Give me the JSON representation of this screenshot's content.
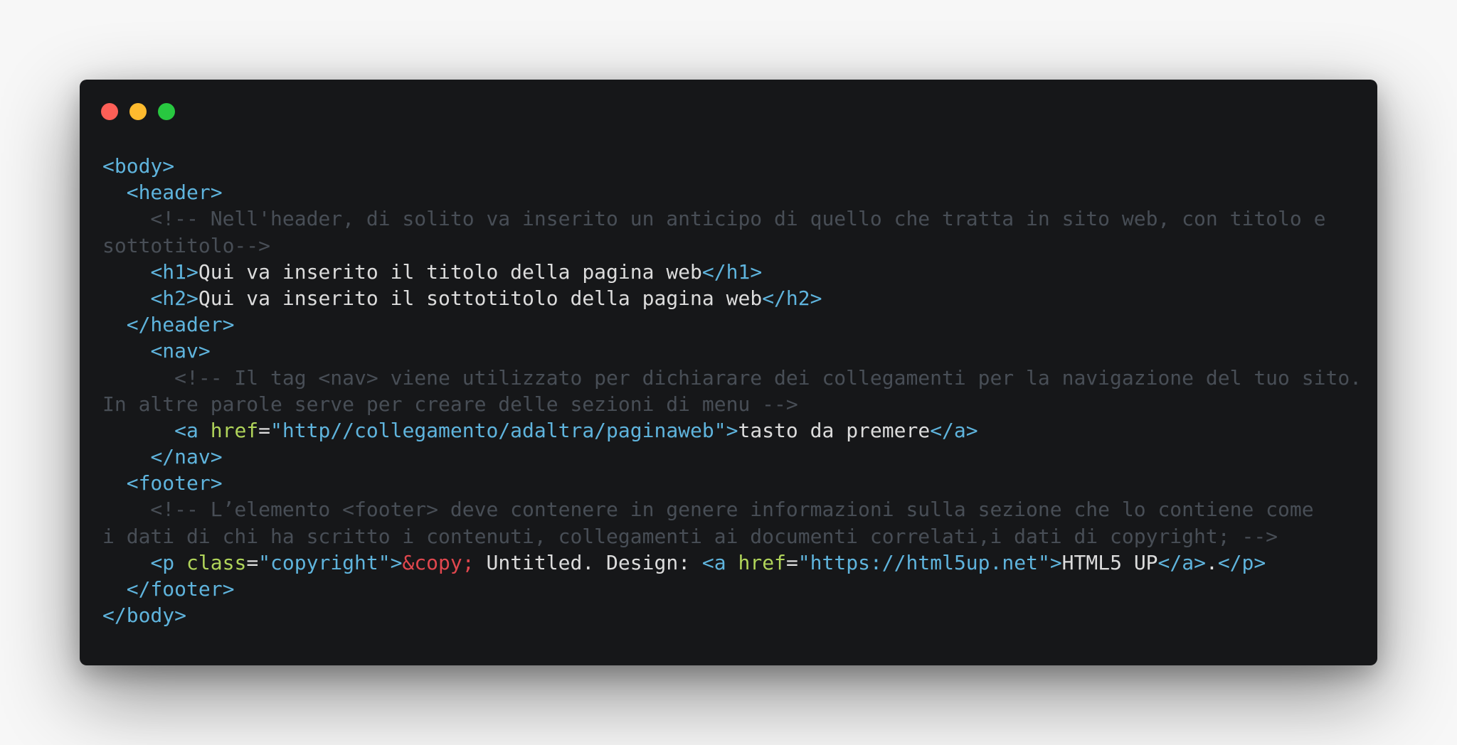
{
  "colors": {
    "background": "#f7f7f7",
    "window": "#161719",
    "tag": "#5fb4dd",
    "attribute": "#b0d45a",
    "string": "#5fb4dd",
    "entity": "#e0474e",
    "comment": "#484e56",
    "text": "#dcdcdc",
    "punctuation": "#dcdcdc"
  },
  "window_controls": [
    {
      "name": "close-button",
      "color": "#fe5f57"
    },
    {
      "name": "minimize-button",
      "color": "#febb2e"
    },
    {
      "name": "zoom-button",
      "color": "#28c840"
    }
  ],
  "code_lines": [
    [
      {
        "t": "tag",
        "v": "<body>"
      }
    ],
    [
      {
        "t": "text",
        "v": "  "
      },
      {
        "t": "tag",
        "v": "<header>"
      }
    ],
    [
      {
        "t": "comment",
        "v": "    <!-- Nell'header, di solito va inserito un anticipo di quello che tratta in sito web, con titolo e"
      }
    ],
    [
      {
        "t": "comment",
        "v": "sottotitolo-->"
      }
    ],
    [
      {
        "t": "text",
        "v": "    "
      },
      {
        "t": "tag",
        "v": "<h1>"
      },
      {
        "t": "text",
        "v": "Qui va inserito il titolo della pagina web"
      },
      {
        "t": "tag",
        "v": "</h1>"
      }
    ],
    [
      {
        "t": "text",
        "v": "    "
      },
      {
        "t": "tag",
        "v": "<h2>"
      },
      {
        "t": "text",
        "v": "Qui va inserito il sottotitolo della pagina web"
      },
      {
        "t": "tag",
        "v": "</h2>"
      }
    ],
    [
      {
        "t": "text",
        "v": "  "
      },
      {
        "t": "tag",
        "v": "</header>"
      }
    ],
    [
      {
        "t": "text",
        "v": "    "
      },
      {
        "t": "tag",
        "v": "<nav>"
      }
    ],
    [
      {
        "t": "comment",
        "v": "      <!-- Il tag <nav> viene utilizzato per dichiarare dei collegamenti per la navigazione del tuo sito."
      }
    ],
    [
      {
        "t": "comment",
        "v": "In altre parole serve per creare delle sezioni di menu -->"
      }
    ],
    [
      {
        "t": "text",
        "v": "      "
      },
      {
        "t": "tag",
        "v": "<a "
      },
      {
        "t": "attribute",
        "v": "href"
      },
      {
        "t": "punctuation",
        "v": "="
      },
      {
        "t": "string",
        "v": "\"http//collegamento/adaltra/paginaweb\""
      },
      {
        "t": "tag",
        "v": ">"
      },
      {
        "t": "text",
        "v": "tasto da premere"
      },
      {
        "t": "tag",
        "v": "</a>"
      }
    ],
    [
      {
        "t": "text",
        "v": "    "
      },
      {
        "t": "tag",
        "v": "</nav>"
      }
    ],
    [
      {
        "t": "text",
        "v": "  "
      },
      {
        "t": "tag",
        "v": "<footer>"
      }
    ],
    [
      {
        "t": "comment",
        "v": "    <!-- L’elemento <footer> deve contenere in genere informazioni sulla sezione che lo contiene come"
      }
    ],
    [
      {
        "t": "comment",
        "v": "i dati di chi ha scritto i contenuti, collegamenti ai documenti correlati,i dati di copyright; -->"
      }
    ],
    [
      {
        "t": "text",
        "v": "    "
      },
      {
        "t": "tag",
        "v": "<p "
      },
      {
        "t": "attribute",
        "v": "class"
      },
      {
        "t": "punctuation",
        "v": "="
      },
      {
        "t": "string",
        "v": "\"copyright\""
      },
      {
        "t": "tag",
        "v": ">"
      },
      {
        "t": "entity",
        "v": "&copy;"
      },
      {
        "t": "text",
        "v": " Untitled. Design: "
      },
      {
        "t": "tag",
        "v": "<a "
      },
      {
        "t": "attribute",
        "v": "href"
      },
      {
        "t": "punctuation",
        "v": "="
      },
      {
        "t": "string",
        "v": "\"https://html5up.net\""
      },
      {
        "t": "tag",
        "v": ">"
      },
      {
        "t": "text",
        "v": "HTML5 UP"
      },
      {
        "t": "tag",
        "v": "</a>"
      },
      {
        "t": "text",
        "v": "."
      },
      {
        "t": "tag",
        "v": "</p>"
      }
    ],
    [
      {
        "t": "text",
        "v": "  "
      },
      {
        "t": "tag",
        "v": "</footer>"
      }
    ],
    [
      {
        "t": "tag",
        "v": "</body>"
      }
    ]
  ]
}
